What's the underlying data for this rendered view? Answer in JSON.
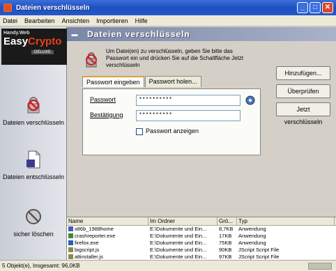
{
  "window": {
    "title": "Dateien verschlüsseln"
  },
  "menu": [
    "Datei",
    "Bearbeiten",
    "Ansichten",
    "Importieren",
    "Hilfe"
  ],
  "logo": {
    "top": "Handy.Web",
    "easy": "Easy",
    "crypto": "Crypto",
    "sub": "DELUXE"
  },
  "sidebar": {
    "actions": [
      {
        "label": "Dateien verschlüsseln"
      },
      {
        "label": "Dateien entschlüsseln"
      },
      {
        "label": "sicher löschen"
      }
    ]
  },
  "panel": {
    "title": "Dateien verschlüsseln",
    "info": "Um Datei(en) zu verschlüsseln, geben Sie bitte das Passwort ein und drücken Sie auf die Schaltfläche Jetzt verschlüsseln",
    "buttons": {
      "add": "Hinzufügen...",
      "remove": "Überprüfen",
      "encrypt": "Jetzt verschlüsseln"
    },
    "tabs": [
      "Passwort eingeben",
      "Passwort holen..."
    ],
    "password_label": "Passwort",
    "password_value": "**********",
    "confirm_label": "Bestätigung",
    "confirm_value": "**********",
    "show_password_label": "Passwort anzeigen"
  },
  "filelist": {
    "headers": [
      "Name",
      "Im Ordner",
      "Grö...",
      "Typ"
    ],
    "rows": [
      {
        "name": "x86b_1988home",
        "folder": "E:\\Dokumente und Ein...",
        "size": "8,7KB",
        "type": "Anwendung",
        "icon_color": "#4a5ab8"
      },
      {
        "name": "crashreporter.exe",
        "folder": "E:\\Dokumente und Ein...",
        "size": "17KB",
        "type": "Anwendung",
        "icon_color": "#3a8a3a"
      },
      {
        "name": "firefox.exe",
        "folder": "E:\\Dokumente und Ein...",
        "size": "75KB",
        "type": "Anwendung",
        "icon_color": "#2e5db8"
      },
      {
        "name": "bigscript.js",
        "folder": "E:\\Dokumente und Ein...",
        "size": "90KB",
        "type": "JScript Script File",
        "icon_color": "#8a8a40"
      },
      {
        "name": "altinstaller.js",
        "folder": "E:\\Dokumente und Ein...",
        "size": "97KB",
        "type": "JScript Script File",
        "icon_color": "#8a8a40"
      }
    ]
  },
  "status": {
    "text": "5 Objekt(e), Insgesamt: 96,0KB"
  }
}
